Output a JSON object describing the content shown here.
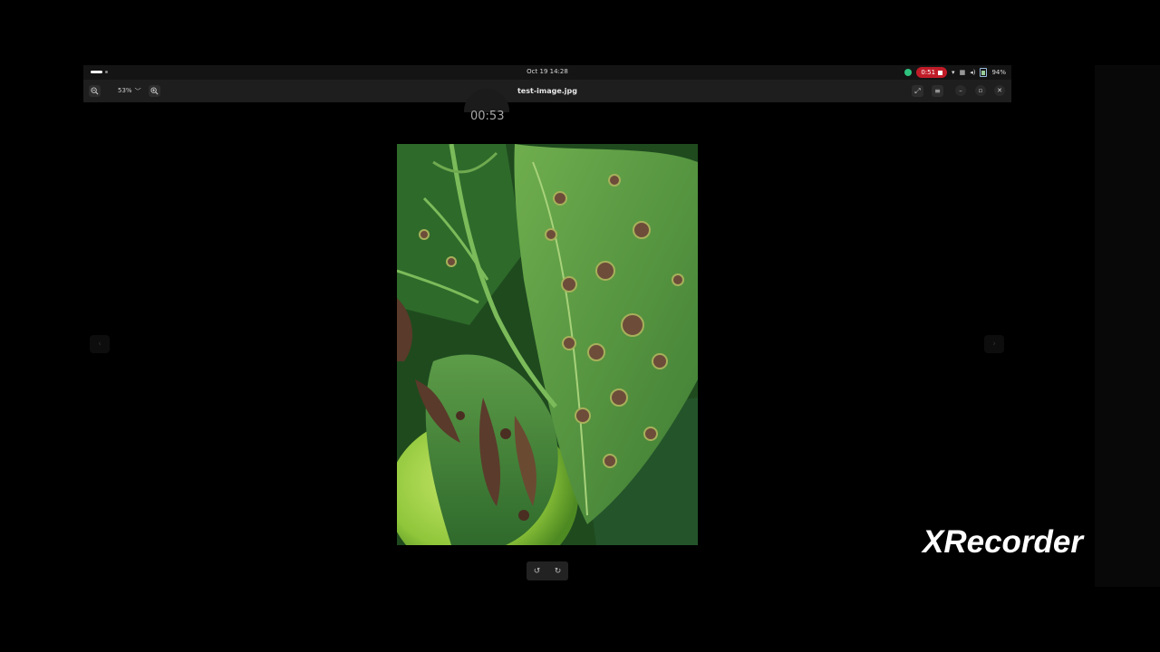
{
  "topbar": {
    "clock": "Oct 19  14:28",
    "recording_time": "0:51",
    "battery_text": "94%"
  },
  "headerbar": {
    "zoom_level": "53%",
    "document_title": "test-image.jpg"
  },
  "overlay": {
    "timer": "00:53"
  },
  "watermark": {
    "text": "XRecorder"
  },
  "colors": {
    "record_red": "#c01c28",
    "app_green": "#2ec27e"
  }
}
